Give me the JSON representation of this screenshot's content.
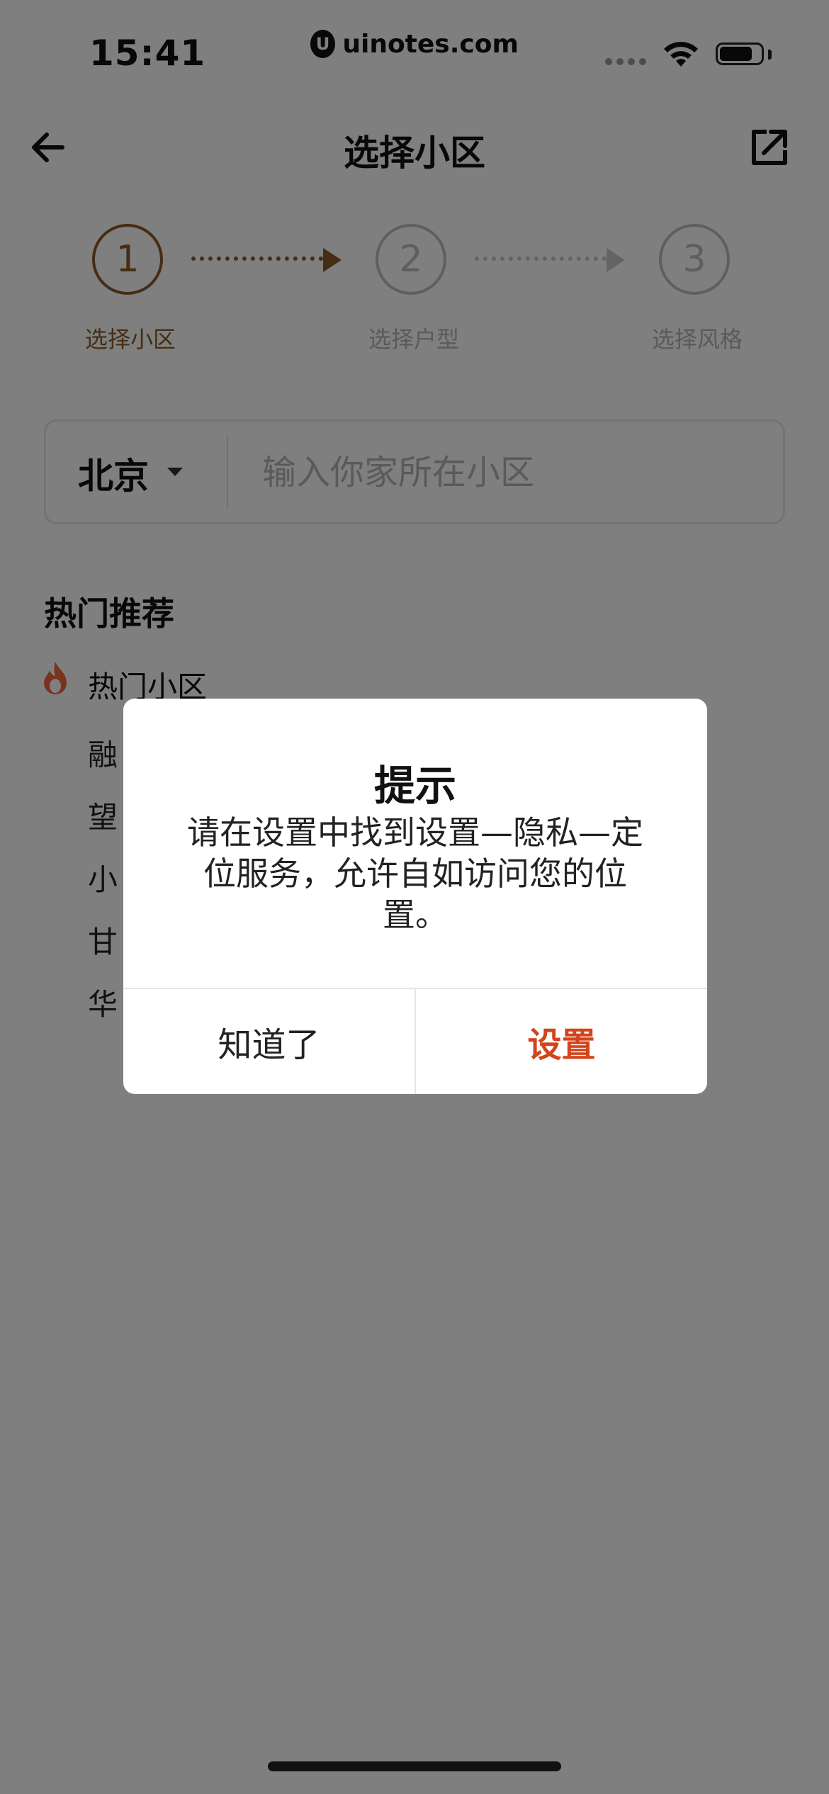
{
  "status_bar": {
    "time": "15:41"
  },
  "watermark": {
    "text": "uinotes.com",
    "logo_glyph": "U"
  },
  "nav": {
    "title": "选择小区",
    "back_icon": "arrow-left-icon",
    "share_icon": "share-external-icon"
  },
  "stepper": {
    "steps": [
      {
        "number": "1",
        "label": "选择小区",
        "active": true
      },
      {
        "number": "2",
        "label": "选择户型",
        "active": false
      },
      {
        "number": "3",
        "label": "选择风格",
        "active": false
      }
    ]
  },
  "search": {
    "city": "北京",
    "placeholder": "输入你家所在小区"
  },
  "hot": {
    "section_title": "热门推荐",
    "category_label": "热门小区",
    "items": [
      "融",
      "望",
      "小",
      "甘",
      "华"
    ]
  },
  "dialog": {
    "title": "提示",
    "message": "请在设置中找到设置—隐私—定位服务，允许自如访问您的位置。",
    "dismiss_label": "知道了",
    "settings_label": "设置"
  },
  "colors": {
    "accent_brown": "#8b5a2b",
    "accent_red": "#d4441c",
    "overlay": "rgba(0,0,0,0.5)"
  }
}
